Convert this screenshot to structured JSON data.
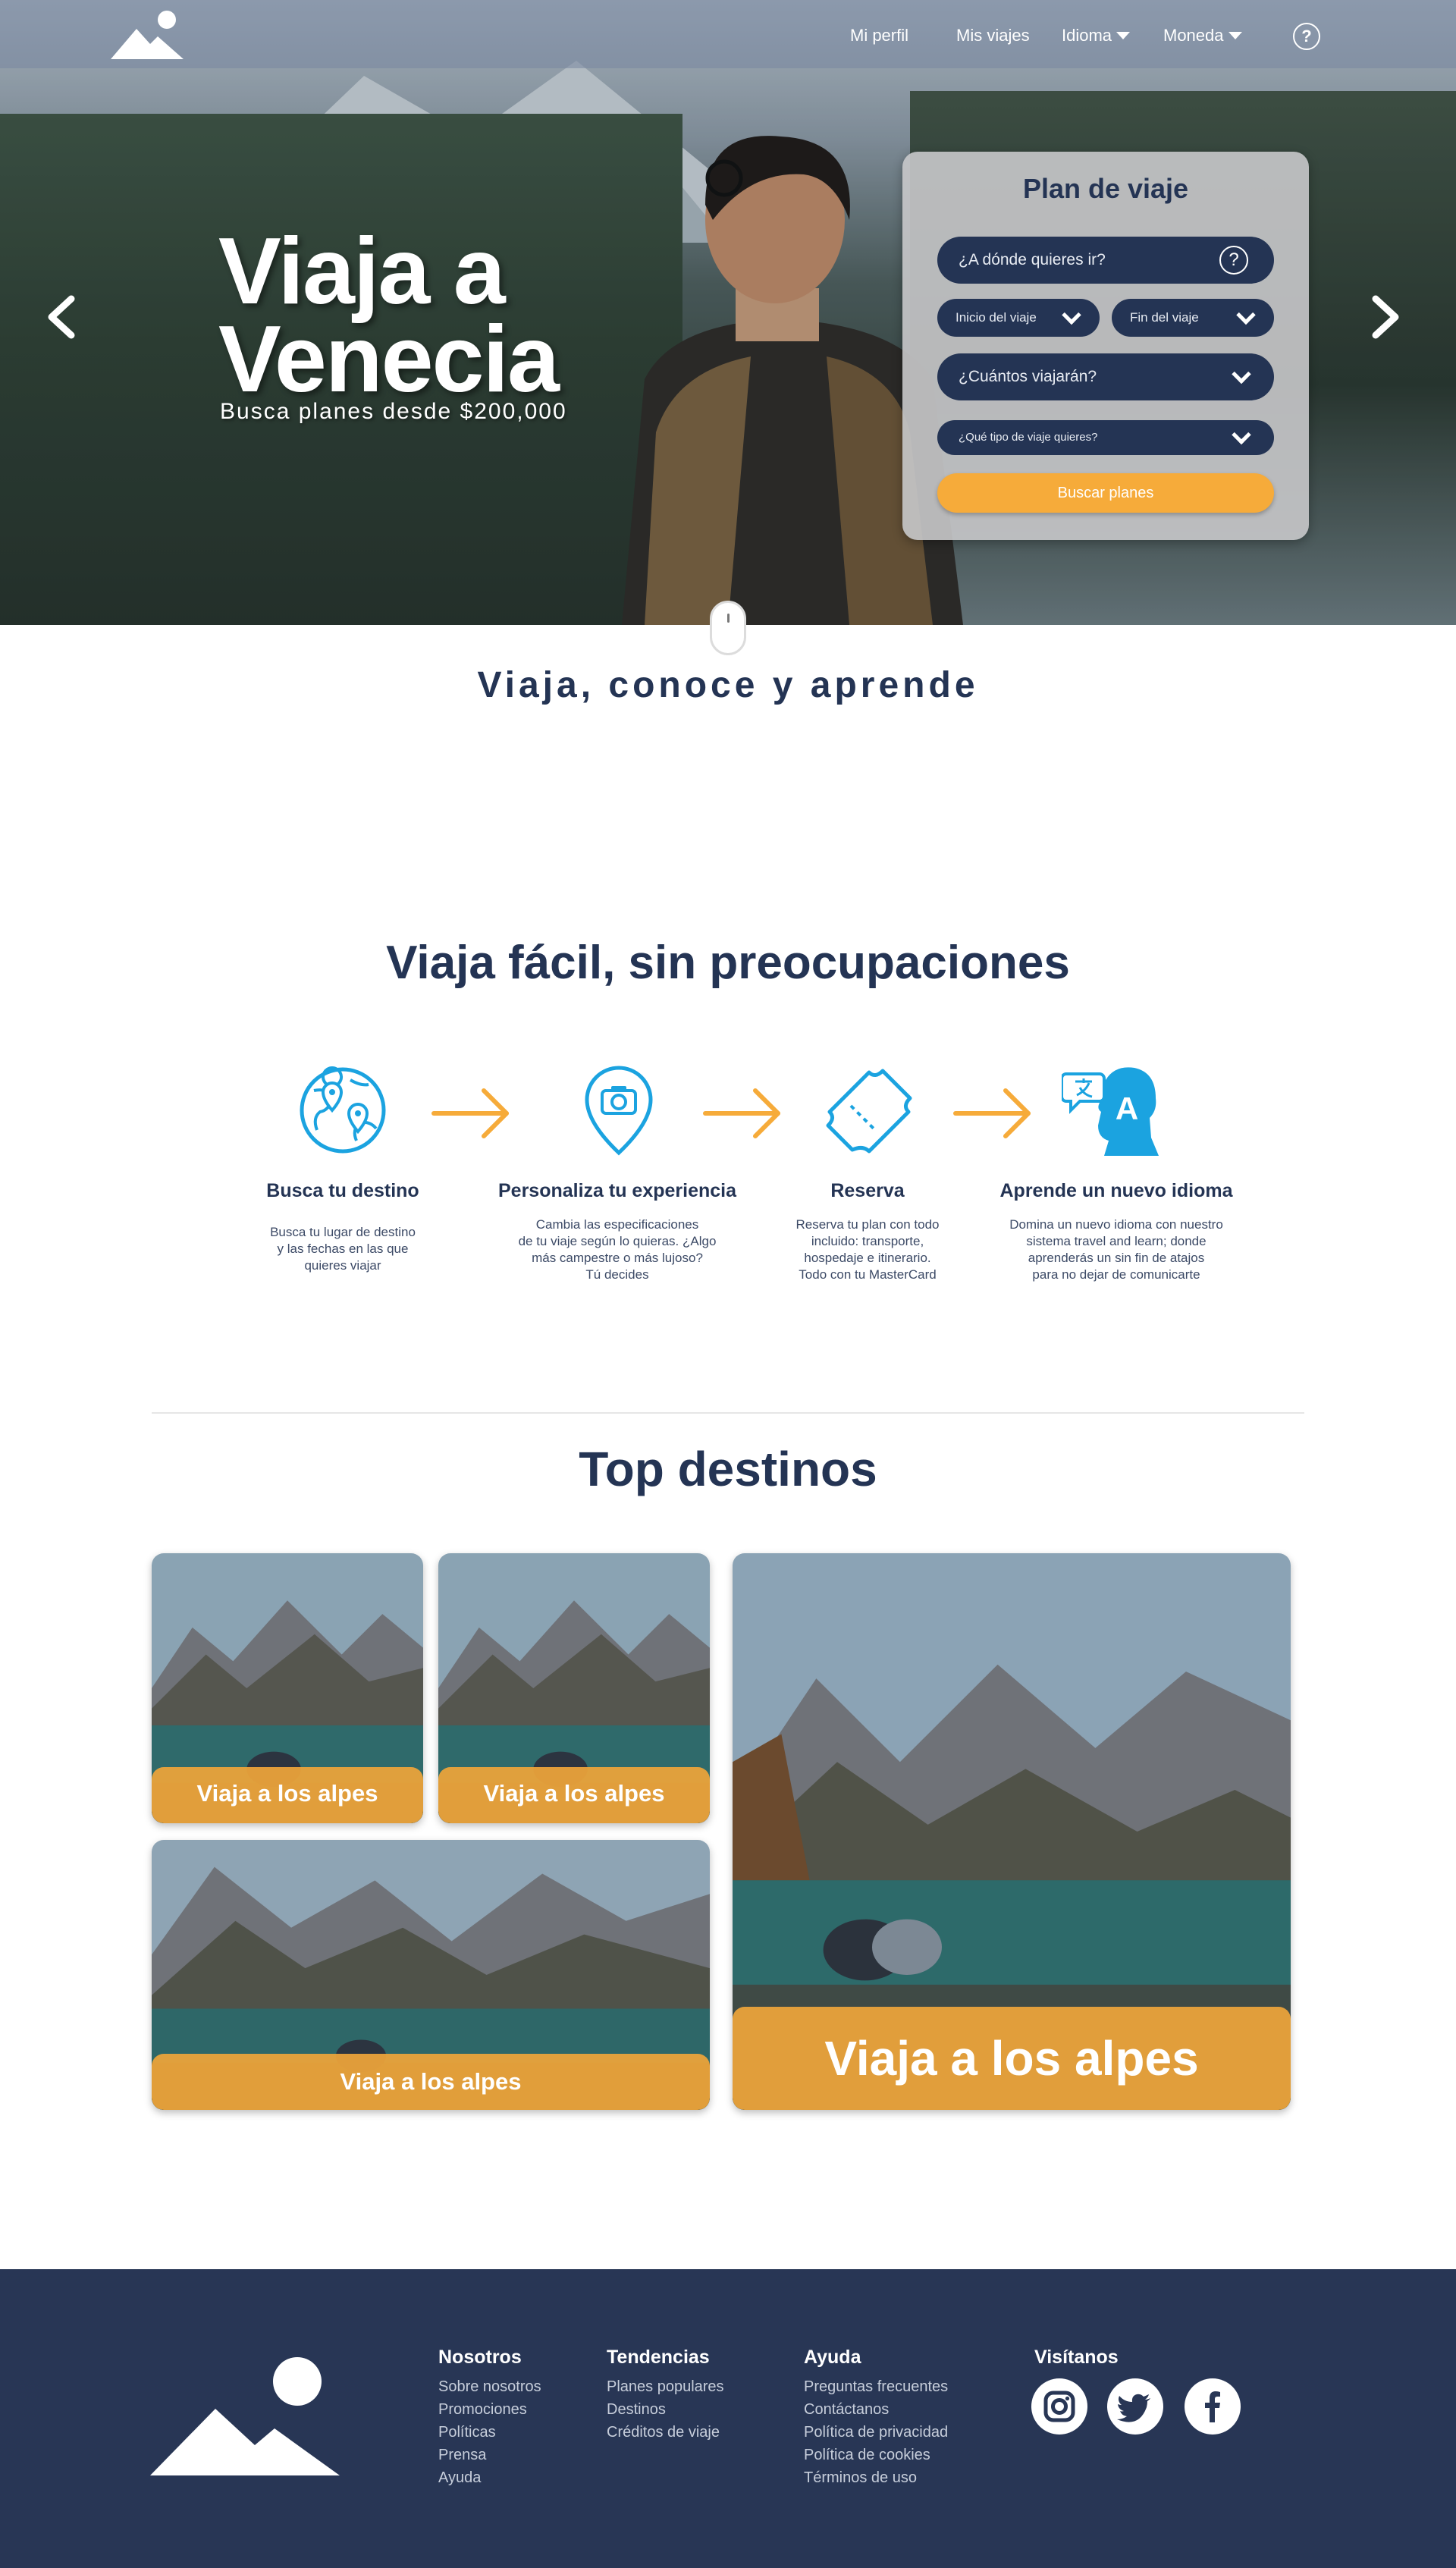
{
  "nav": {
    "items": [
      "Mi perfil",
      "Mis viajes",
      "Idioma",
      "Moneda"
    ],
    "help": "?"
  },
  "hero": {
    "title_line1": "Viaja a",
    "title_line2": "Venecia",
    "subtitle": "Busca planes desde $200,000"
  },
  "plan": {
    "title": "Plan de viaje",
    "destination_placeholder": "¿A dónde quieres ir?",
    "help": "?",
    "start": "Inicio del viaje",
    "end": "Fin del viaje",
    "travelers": "¿Cuántos viajarán?",
    "trip_type": "¿Qué tipo de viaje quieres?",
    "search_button": "Buscar planes"
  },
  "tagline": "Viaja, conoce y aprende",
  "steps": {
    "title": "Viaja fácil, sin preocupaciones",
    "items": [
      {
        "name": "Busca tu destino",
        "desc": "Busca tu lugar de destino\ny las fechas en las que\nquieres viajar",
        "icon": "globe-pins-icon"
      },
      {
        "name": "Personaliza tu experiencia",
        "desc": "Cambia las especificaciones\nde tu viaje según lo quieras. ¿Algo\nmás campestre o más lujoso?\nTú decides",
        "icon": "camera-pin-icon"
      },
      {
        "name": "Reserva",
        "desc": "Reserva tu plan con todo\nincluido: transporte,\nhospedaje e itinerario.\nTodo con tu MasterCard",
        "icon": "ticket-icon"
      },
      {
        "name": "Aprende un nuevo idioma",
        "desc": "Domina un nuevo idioma con nuestro\nsistema travel and learn; donde\naprenderás un sin fin de atajos\npara no dejar de comunicarte",
        "icon": "language-head-icon"
      }
    ]
  },
  "destinations": {
    "title": "Top destinos",
    "cards": [
      "Viaja a los alpes",
      "Viaja a los alpes",
      "Viaja a los alpes",
      "Viaja a los alpes"
    ]
  },
  "footer": {
    "cols": [
      {
        "title": "Nosotros",
        "links": [
          "Sobre nosotros",
          "Promociones",
          "Políticas",
          "Prensa",
          "Ayuda"
        ]
      },
      {
        "title": "Tendencias",
        "links": [
          "Planes populares",
          "Destinos",
          "Créditos de viaje"
        ]
      },
      {
        "title": "Ayuda",
        "links": [
          "Preguntas frecuentes",
          "Contáctanos",
          "Política de privacidad",
          "Política de cookies",
          "Términos de uso"
        ]
      }
    ],
    "social_title": "Visítanos",
    "social": [
      "instagram-icon",
      "twitter-icon",
      "facebook-icon"
    ]
  },
  "colors": {
    "navy": "#243454",
    "accent": "#f6ab3a",
    "icon_blue": "#1ba3e0",
    "footer_bg": "#283655"
  }
}
